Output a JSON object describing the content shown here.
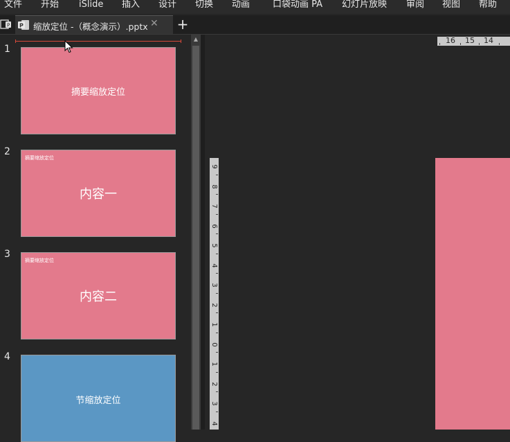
{
  "menu": {
    "items": [
      "文件",
      "开始",
      "iSlide",
      "插入",
      "设计",
      "切换",
      "动画",
      "口袋动画 PA",
      "幻灯片放映",
      "审阅",
      "视图",
      "帮助"
    ]
  },
  "tabbar": {
    "tab_title": "缩放定位  -（概念演示）.pptx",
    "close_glyph": "✕",
    "more_glyph": "⋮",
    "new_tab_glyph": "+"
  },
  "slides": [
    {
      "number": "1",
      "center_text": "摘要缩放定位",
      "corner_text": ""
    },
    {
      "number": "2",
      "center_text": "内容一",
      "corner_text": "摘要缩放定位"
    },
    {
      "number": "3",
      "center_text": "内容二",
      "corner_text": "摘要缩放定位"
    },
    {
      "number": "4",
      "center_text": "节缩放定位",
      "corner_text": ""
    }
  ],
  "ruler": {
    "horizontal_labels": [
      "16",
      "15",
      "14"
    ],
    "vertical_labels": [
      "9",
      "8",
      "7",
      "6",
      "5",
      "4",
      "3",
      "2",
      "1",
      "0",
      "1",
      "2",
      "3",
      "4"
    ]
  },
  "colors": {
    "slide_pink": "#e37a8c",
    "slide_blue": "#5b97c4",
    "insert_line": "#d94a3a"
  },
  "icons": {
    "app": "presentation-app-icon",
    "file": "powerpoint-file-icon",
    "cursor": "mouse-pointer-icon"
  }
}
